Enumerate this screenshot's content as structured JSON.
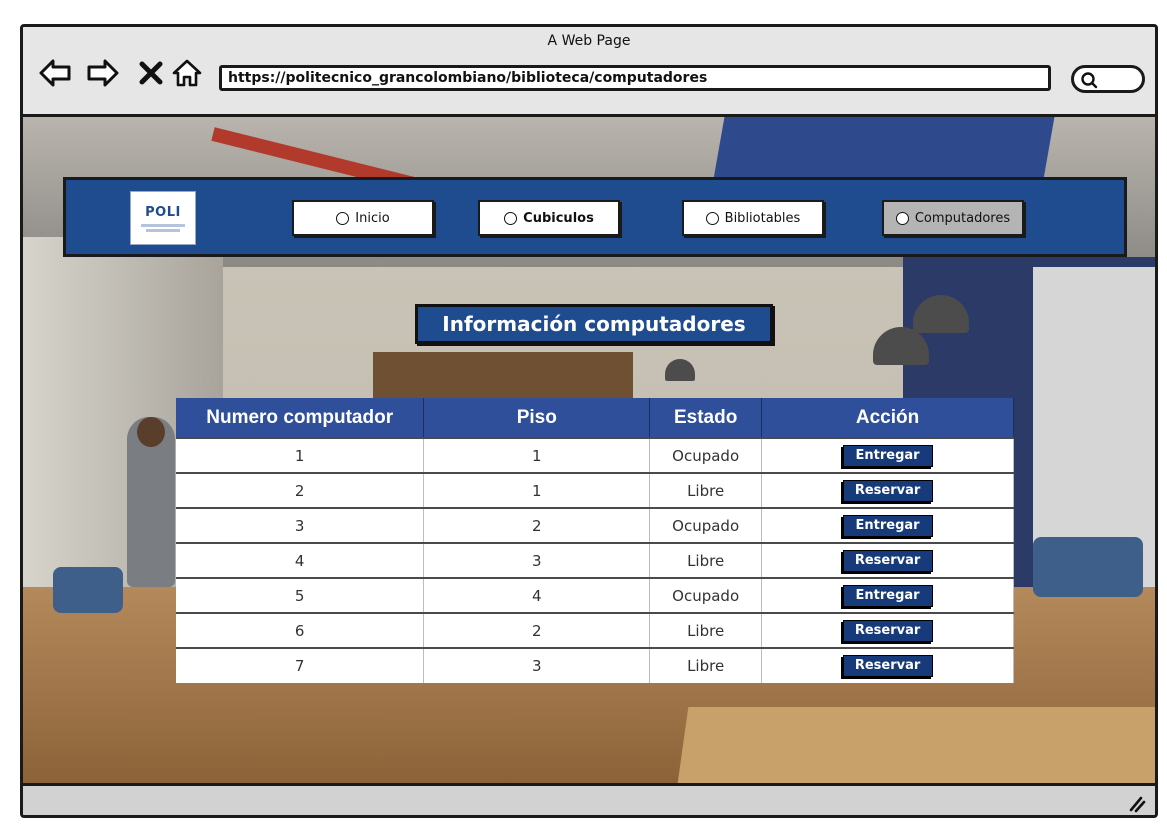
{
  "window": {
    "title": "A Web Page",
    "url": "https://politecnico_grancolombiano/biblioteca/computadores"
  },
  "icons": {
    "back": "back-arrow-icon",
    "forward": "forward-arrow-icon",
    "stop": "close-icon",
    "home": "home-icon",
    "search": "search-icon",
    "radio": "radio-icon",
    "resize": "resize-grip-icon"
  },
  "header": {
    "logo_text": "POLI",
    "nav": [
      {
        "label": "Inicio",
        "active": false
      },
      {
        "label": "Cubiculos",
        "active": false
      },
      {
        "label": "Bibliotables",
        "active": false
      },
      {
        "label": "Computadores",
        "active": true
      }
    ]
  },
  "main": {
    "title": "Información computadores",
    "table": {
      "columns": [
        "Numero computador",
        "Piso",
        "Estado",
        "Acción"
      ],
      "rows": [
        {
          "numero": "1",
          "piso": "1",
          "estado": "Ocupado",
          "accion": "Entregar"
        },
        {
          "numero": "2",
          "piso": "1",
          "estado": "Libre",
          "accion": "Reservar"
        },
        {
          "numero": "3",
          "piso": "2",
          "estado": "Ocupado",
          "accion": "Entregar"
        },
        {
          "numero": "4",
          "piso": "3",
          "estado": "Libre",
          "accion": "Reservar"
        },
        {
          "numero": "5",
          "piso": "4",
          "estado": "Ocupado",
          "accion": "Entregar"
        },
        {
          "numero": "6",
          "piso": "2",
          "estado": "Libre",
          "accion": "Reservar"
        },
        {
          "numero": "7",
          "piso": "3",
          "estado": "Libre",
          "accion": "Reservar"
        }
      ]
    }
  },
  "colors": {
    "brand_blue": "#1f4b8f",
    "table_header": "#2f4f9a",
    "button_blue": "#173b7a",
    "active_tab": "#b4b4b4"
  }
}
